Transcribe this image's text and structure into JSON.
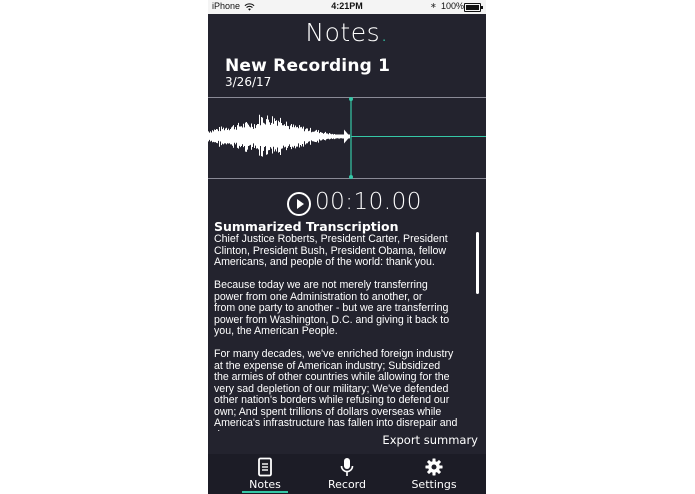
{
  "status_bar": {
    "carrier": "iPhone",
    "time": "4:21PM",
    "battery_percent": "100%",
    "icons": [
      "wifi-icon",
      "bluetooth-icon",
      "battery-icon"
    ]
  },
  "app": {
    "title": "Notes",
    "title_dot": ".",
    "accent_color": "#35c7a6",
    "background_color": "#23232e"
  },
  "recording": {
    "title": "New Recording 1",
    "date": "3/26/17",
    "elapsed": "00:10.00",
    "playhead_progress": 0.51
  },
  "summary": {
    "heading": "Summarized Transcription",
    "paragraphs": [
      "Chief Justice Roberts, President Carter, President\nClinton, President Bush, President Obama, fellow\n Americans, and people of the world: thank you.",
      "Because today we are not merely transferring\npower from one Administration to another, or\nfrom one party to another - but we are transferring\n power from Washington, D.C. and giving it back to\nyou, the American People.",
      "For many decades, we've enriched foreign industry\nat the expense of American industry; Subsidized\nthe armies of other countries while allowing for the\nvery sad depletion of our military; We've defended\nother nation's borders while refusing to defend our\nown; And spent trillions of dollars overseas while\nAmerica's infrastructure has fallen into disrepair and\ndecay."
    ],
    "export_label": "Export summary"
  },
  "tabbar": {
    "tabs": [
      {
        "label": "Notes",
        "icon": "document-icon",
        "active": true
      },
      {
        "label": "Record",
        "icon": "microphone-icon",
        "active": false
      },
      {
        "label": "Settings",
        "icon": "gear-icon",
        "active": false
      }
    ]
  }
}
